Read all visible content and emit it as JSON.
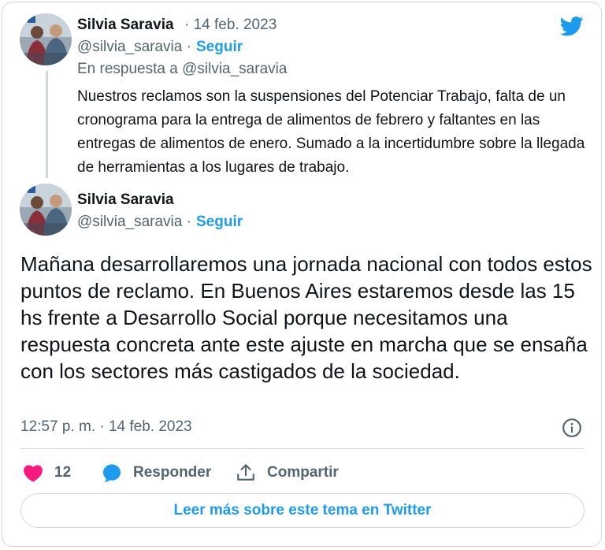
{
  "colors": {
    "accent": "#1d9bf0",
    "like": "#f91880",
    "muted": "#536471",
    "text": "#0f1419",
    "border": "#cfd9de"
  },
  "parent_tweet": {
    "author_name": "Silvia Saravia",
    "date": "· 14 feb. 2023",
    "handle": "@silvia_saravia ·",
    "follow_label": "Seguir",
    "reply_to": "En respuesta a @silvia_saravia",
    "text": "Nuestros reclamos son la suspensiones del Potenciar Trabajo, falta de un cronograma para la entrega de alimentos de febrero y faltantes en las entregas de alimentos de enero. Sumado a la incertidumbre sobre la llegada de herramientas a los lugares de trabajo."
  },
  "main_tweet": {
    "author_name": "Silvia Saravia",
    "handle": "@silvia_saravia ·",
    "follow_label": "Seguir",
    "text": "Mañana desarrollaremos una jornada nacional con todos estos puntos de reclamo. En Buenos Aires estaremos desde las 15 hs frente a Desarrollo Social porque necesitamos una respuesta concreta ante este ajuste en marcha que se ensaña con los sectores más castigados de la sociedad.",
    "timestamp": "12:57 p. m. · 14 feb. 2023"
  },
  "actions": {
    "like_count": "12",
    "reply_label": "Responder",
    "share_label": "Compartir"
  },
  "read_more_label": "Leer más sobre este tema en Twitter",
  "icons": [
    "twitter-bird-icon",
    "info-icon",
    "heart-icon",
    "reply-bubble-icon",
    "share-icon"
  ]
}
